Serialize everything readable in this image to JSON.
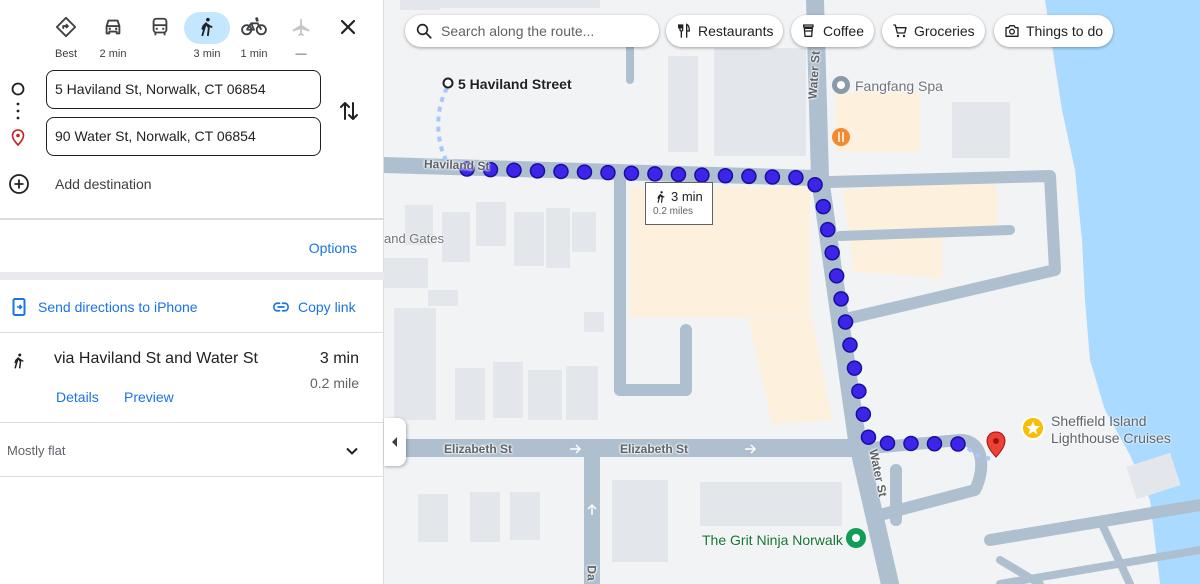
{
  "travel_modes": [
    {
      "name": "best",
      "label": "Best",
      "icon": "diamond-directions-icon",
      "active": false
    },
    {
      "name": "driving",
      "label": "2 min",
      "icon": "car-icon",
      "active": false
    },
    {
      "name": "transit",
      "label": "",
      "icon": "bus-icon",
      "active": false
    },
    {
      "name": "walking",
      "label": "3 min",
      "icon": "walk-icon",
      "active": true
    },
    {
      "name": "cycling",
      "label": "1 min",
      "icon": "bicycle-icon",
      "active": false
    },
    {
      "name": "flights",
      "label": "—",
      "icon": "airplane-icon",
      "active": false
    }
  ],
  "origin": "5 Haviland St, Norwalk, CT 06854",
  "destination": "90 Water St, Norwalk, CT 06854",
  "add_destination": "Add destination",
  "options_label": "Options",
  "send_directions": "Send directions to iPhone",
  "copy_link": "Copy link",
  "route": {
    "via": "via Haviland St and Water St",
    "time": "3 min",
    "distance": "0.2 mile",
    "details": "Details",
    "preview": "Preview",
    "terrain": "Mostly flat"
  },
  "map": {
    "search_placeholder": "Search along the route...",
    "chips": [
      "Restaurants",
      "Coffee",
      "Groceries",
      "Things to do"
    ],
    "start_label": "5 Haviland Street",
    "tooltip_time": "3 min",
    "tooltip_distance": "0.2 miles",
    "streets": {
      "haviland": "Haviland St",
      "water_top": "Water St",
      "water_bottom": "Water St",
      "elizabeth_1": "Elizabeth St",
      "elizabeth_2": "Elizabeth St",
      "da": "Da"
    },
    "pois": {
      "fangfang": "Fangfang Spa",
      "gates": "and Gates",
      "sheffield_1": "Sheffield Island",
      "sheffield_2": "Lighthouse Cruises",
      "grit": "The Grit Ninja Norwalk"
    }
  },
  "colors": {
    "accent": "#1a73e8",
    "route_dot": "#3c25e8",
    "water": "#aadaff",
    "road": "#aebfcf",
    "pin": "#ea4335"
  }
}
